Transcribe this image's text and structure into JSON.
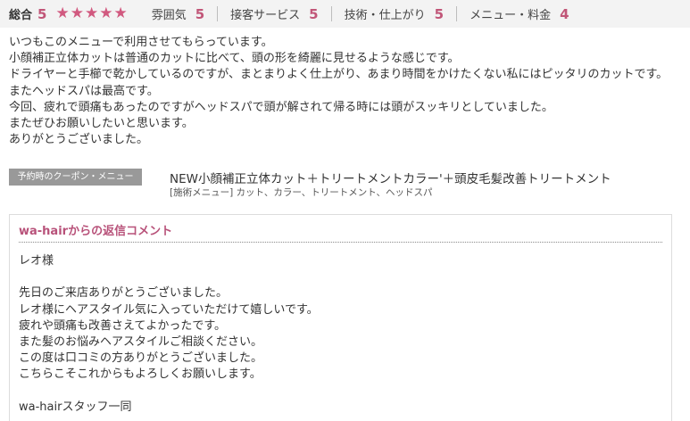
{
  "ratings": {
    "overall_label": "総合",
    "overall_score": "5",
    "stars": [
      "★",
      "★",
      "★",
      "★",
      "★"
    ],
    "star_color": "#d1597f",
    "items": [
      {
        "label": "雰囲気",
        "score": "5"
      },
      {
        "label": "接客サービス",
        "score": "5"
      },
      {
        "label": "技術・仕上がり",
        "score": "5"
      },
      {
        "label": "メニュー・料金",
        "score": "4"
      }
    ]
  },
  "review": {
    "lines": [
      "いつもこのメニューで利用させてもらっています。",
      "小顔補正立体カットは普通のカットに比べて、頭の形を綺麗に見せるような感じです。",
      "ドライヤーと手櫛で乾かしているのですが、まとまりよく仕上がり、あまり時間をかけたくない私にはピッタリのカットです。",
      "またヘッドスパは最高です。",
      "今回、疲れで頭痛もあったのですがヘッドスパで頭が解されて帰る時には頭がスッキリとしていました。",
      "またぜひお願いしたいと思います。",
      "ありがとうございました。"
    ]
  },
  "coupon": {
    "badge": "予約時のクーポン・メニュー",
    "title": "NEW小顔補正立体カット＋トリートメントカラー'＋頭皮毛髪改善トリートメント",
    "menu": "[施術メニュー] カット、カラー、トリートメント、ヘッドスパ"
  },
  "reply": {
    "title": "wa-hairからの返信コメント",
    "title_color": "#b8527a",
    "lines": [
      "レオ様",
      "",
      "先日のご来店ありがとうございました。",
      "レオ様にヘアスタイル気に入っていただけて嬉しいです。",
      "疲れや頭痛も改善さえてよかったです。",
      "また髪のお悩みヘアスタイルご相談ください。",
      "この度は口コミの方ありがとうございました。",
      "こちらこそこれからもよろしくお願いします。",
      "",
      "wa-hairスタッフ一同"
    ]
  }
}
